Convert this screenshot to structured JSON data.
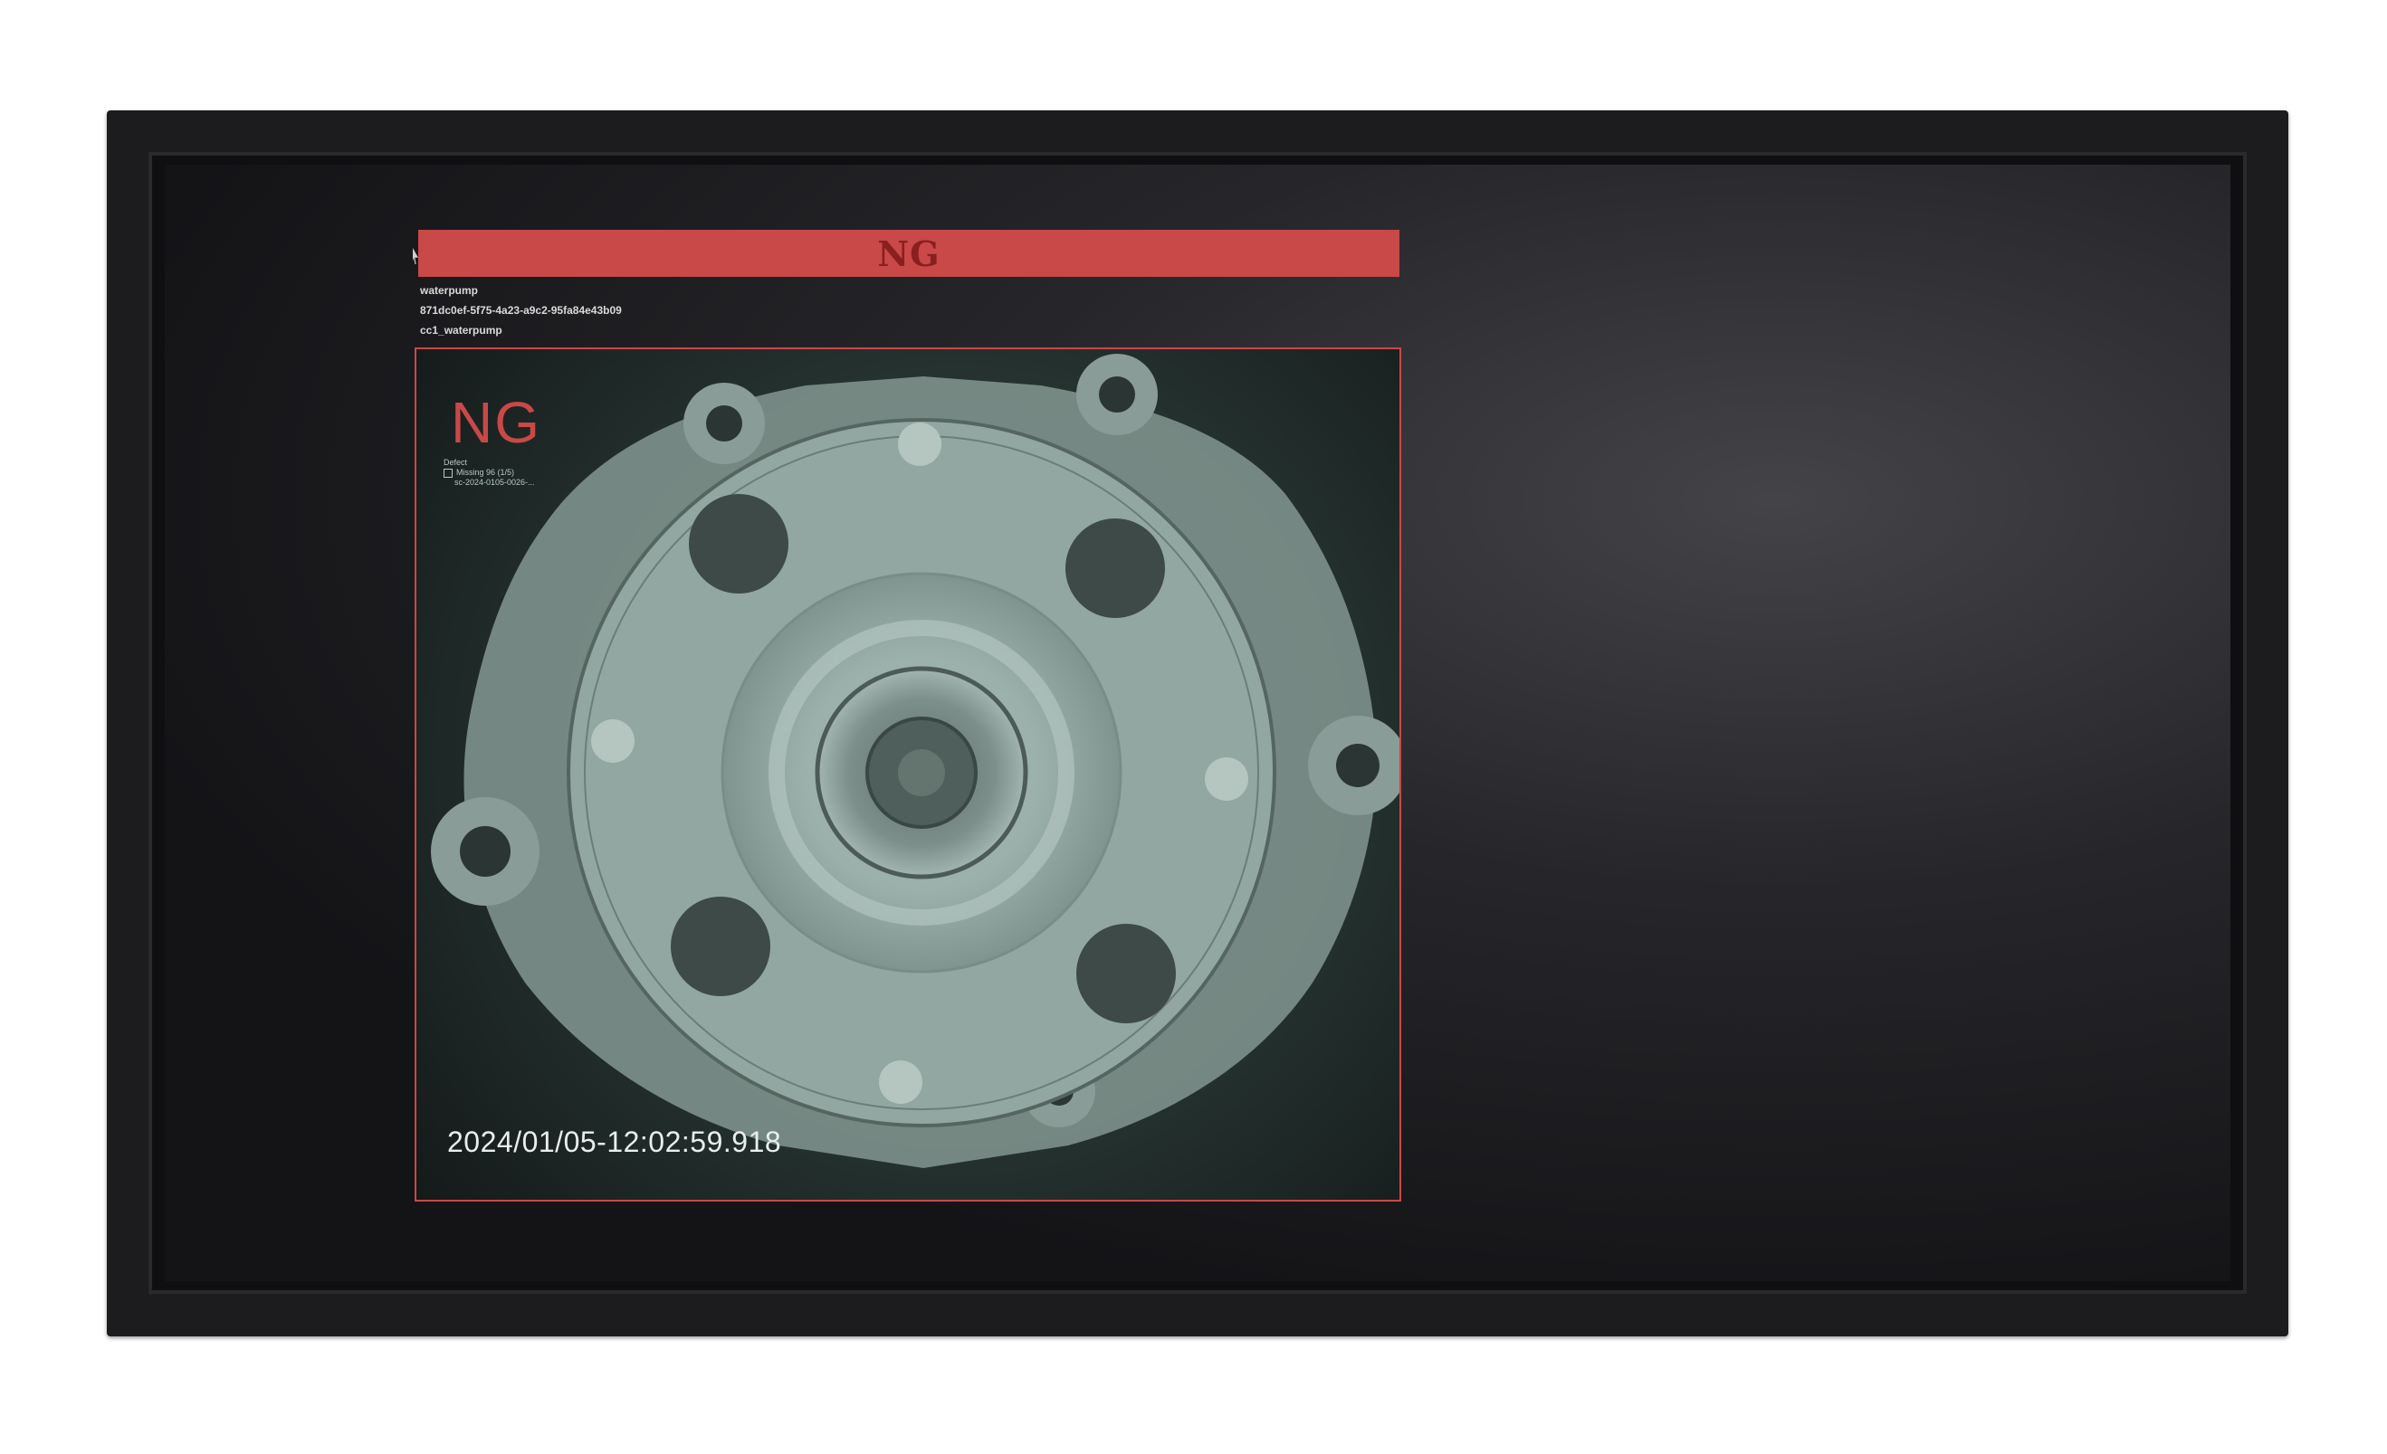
{
  "inspection": {
    "result_banner": "NG",
    "part_name": "waterpump",
    "record_id": "871dc0ef-5f75-4a23-a9c2-95fa84e43b09",
    "model_name": "cc1_waterpump",
    "overlay_result": "NG",
    "overlay_legend_title": "Defect",
    "overlay_legend_line1": "Missing   96 (1/5)",
    "overlay_legend_line2": "sc-2024-0105-0026-...",
    "timestamp": "2024/01/05-12:02:59.918"
  },
  "colors": {
    "ng_red": "#c94848",
    "monitor_bezel": "#1c1c1e",
    "part_tint": "#9fb2ad"
  },
  "icons": {
    "cursor": "mouse-pointer-icon"
  }
}
